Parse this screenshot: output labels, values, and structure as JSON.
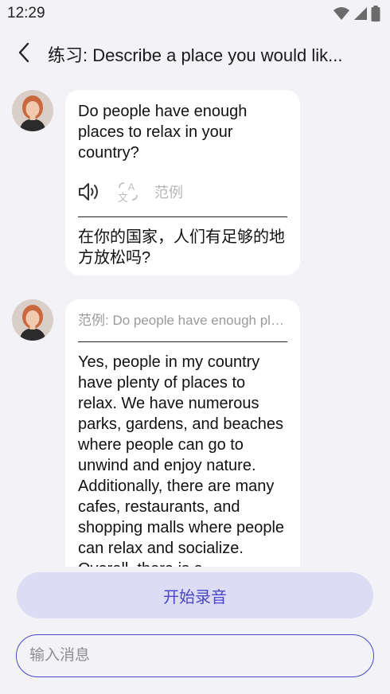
{
  "status": {
    "time": "12:29"
  },
  "header": {
    "title": "练习: Describe a place you would lik..."
  },
  "messages": [
    {
      "text": "Do people have enough places to relax in your country?",
      "example_link": "范例",
      "translation": "在你的国家，人们有足够的地方放松吗?"
    },
    {
      "example_header": "范例: Do people have enough places to relax in your country?",
      "text": "Yes, people in my country have plenty of places to relax. We have numerous parks, gardens, and beaches where people can go to unwind and enjoy nature. Additionally, there are many cafes, restaurants, and shopping malls where people can relax and socialize. Overall, there is a"
    }
  ],
  "record_button": {
    "label": "开始录音"
  },
  "message_input": {
    "placeholder": "输入消息"
  },
  "colors": {
    "accent": "#4a47c8",
    "record_bg": "#dcdcf4",
    "page_bg": "#f3f2f7"
  }
}
